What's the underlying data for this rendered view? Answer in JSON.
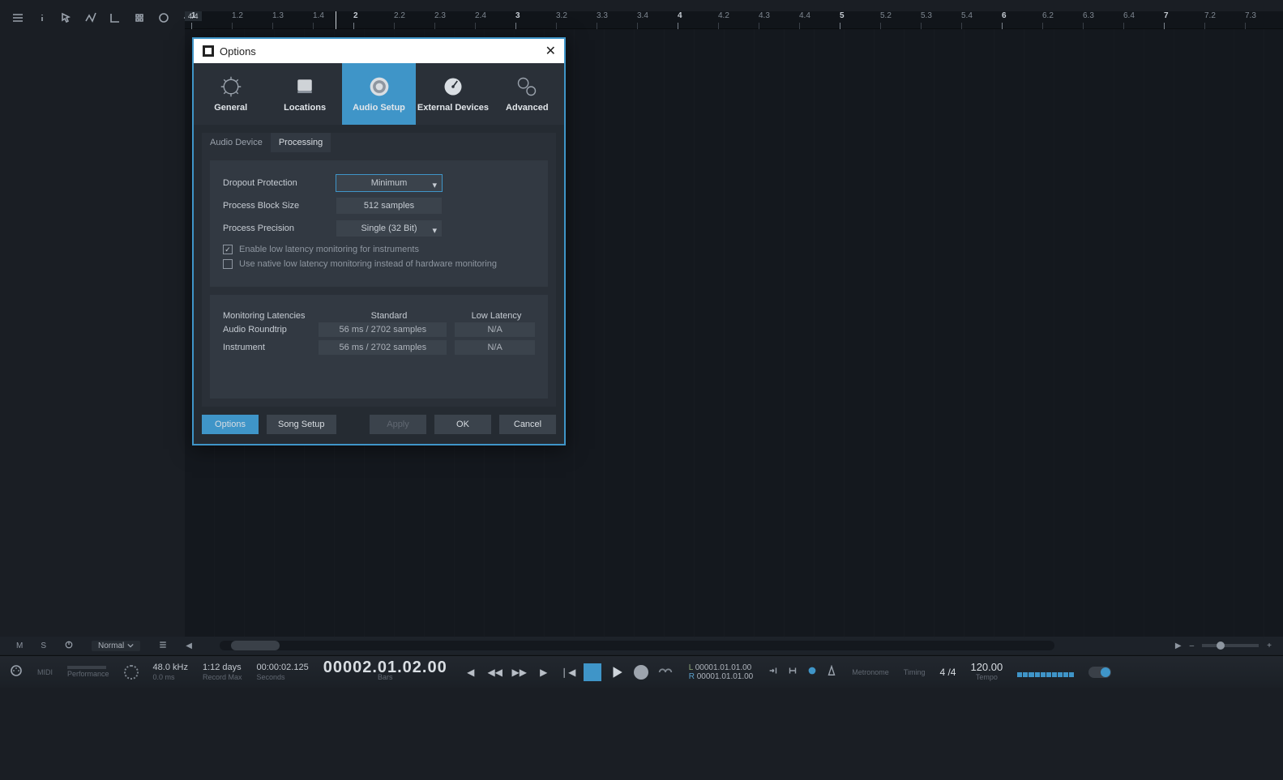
{
  "toolbar_icons": [
    "menu",
    "info",
    "arrow",
    "automation",
    "bend",
    "paint",
    "marker",
    "clock",
    "plus"
  ],
  "ruler": {
    "flag": "4/4",
    "ticks": [
      "1",
      "1.2",
      "1.3",
      "1.4",
      "2",
      "2.2",
      "2.3",
      "2.4",
      "3",
      "3.2",
      "3.3",
      "3.4",
      "4",
      "4.2",
      "4.3",
      "4.4",
      "5",
      "5.2",
      "5.3",
      "5.4",
      "6",
      "6.2",
      "6.3",
      "6.4",
      "7",
      "7.2",
      "7.3"
    ]
  },
  "trackstrip": {
    "m": "M",
    "s": "S",
    "mode": "Normal"
  },
  "transport": {
    "midi": "MIDI",
    "perf": "Performance",
    "khz": "48.0 kHz",
    "lat": "0.0 ms",
    "rec1": "1:12 days",
    "rec2": "Record Max",
    "sec1": "00:00:02.125",
    "sec2": "Seconds",
    "main": "00002.01.02.00",
    "main2": "Bars",
    "locL": "00001.01.01.00",
    "locR": "00001.01.01.00",
    "metro": "Metronome",
    "timing": "Timing",
    "tempolbl": "Tempo",
    "sig": "4 /4",
    "bpm": "120.00"
  },
  "dialog": {
    "title": "Options",
    "cats": [
      "General",
      "Locations",
      "Audio Setup",
      "External Devices",
      "Advanced"
    ],
    "tabs": [
      "Audio Device",
      "Processing"
    ],
    "dropout_k": "Dropout Protection",
    "dropout_v": "Minimum",
    "block_k": "Process Block Size",
    "block_v": "512 samples",
    "prec_k": "Process Precision",
    "prec_v": "Single (32 Bit)",
    "chk1": "Enable low latency monitoring for instruments",
    "chk2": "Use native low latency monitoring instead of hardware monitoring",
    "lat_head": [
      "Monitoring Latencies",
      "Standard",
      "Low Latency"
    ],
    "lat_rows": [
      {
        "k": "Audio Roundtrip",
        "a": "56 ms / 2702 samples",
        "b": "N/A"
      },
      {
        "k": "Instrument",
        "a": "56 ms / 2702 samples",
        "b": "N/A"
      }
    ],
    "footer": {
      "options": "Options",
      "song": "Song Setup",
      "apply": "Apply",
      "ok": "OK",
      "cancel": "Cancel"
    }
  }
}
